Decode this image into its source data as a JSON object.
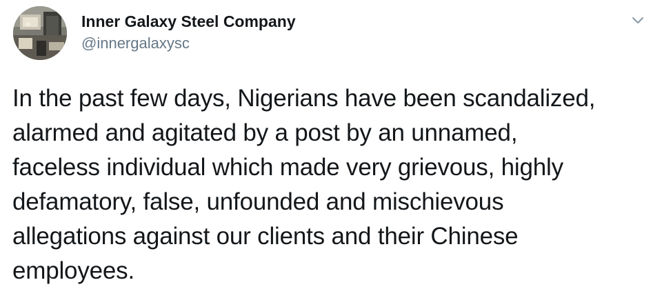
{
  "tweet": {
    "author": {
      "display_name": "Inner Galaxy Steel Company",
      "handle": "@innergalaxysc",
      "avatar_icon": "company-photo-avatar"
    },
    "menu_icon": "chevron-down-icon",
    "text_lines": [
      "In the past few days, Nigerians have been scandalized,",
      "alarmed and agitated by a post by an unnamed,",
      "faceless individual which made very grievous, highly",
      "defamatory, false, unfounded and mischievous",
      "allegations against our clients and their Chinese",
      "employees."
    ]
  },
  "colors": {
    "text": "#14171a",
    "secondary": "#657786",
    "background": "#ffffff"
  }
}
